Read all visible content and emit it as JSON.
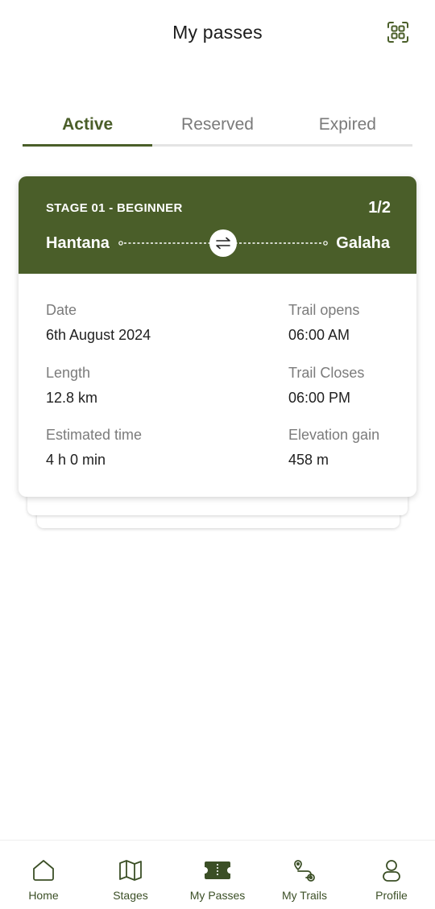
{
  "header": {
    "title": "My passes",
    "qr_icon": "qr-scan-icon"
  },
  "tabs": [
    {
      "label": "Active",
      "active": true
    },
    {
      "label": "Reserved",
      "active": false
    },
    {
      "label": "Expired",
      "active": false
    }
  ],
  "pass": {
    "stage": "STAGE 01 - BEGINNER",
    "count": "1/2",
    "from": "Hantana",
    "to": "Galaha",
    "swap_icon": "swap-arrows-icon",
    "details": {
      "date_label": "Date",
      "date_value": "6th August 2024",
      "opens_label": "Trail opens",
      "opens_value": "06:00 AM",
      "length_label": "Length",
      "length_value": "12.8 km",
      "closes_label": "Trail Closes",
      "closes_value": "06:00 PM",
      "time_label": "Estimated time",
      "time_value": "4 h 0 min",
      "elevation_label": "Elevation gain",
      "elevation_value": "458 m"
    }
  },
  "nav": {
    "items": [
      {
        "label": "Home",
        "icon": "home-icon"
      },
      {
        "label": "Stages",
        "icon": "map-icon"
      },
      {
        "label": "My Passes",
        "icon": "ticket-icon",
        "active": true
      },
      {
        "label": "My Trails",
        "icon": "route-icon"
      },
      {
        "label": "Profile",
        "icon": "user-icon"
      }
    ]
  },
  "colors": {
    "accent": "#4a5e29",
    "tab_inactive": "#7a7a7a",
    "divider": "#e4e4e4"
  }
}
